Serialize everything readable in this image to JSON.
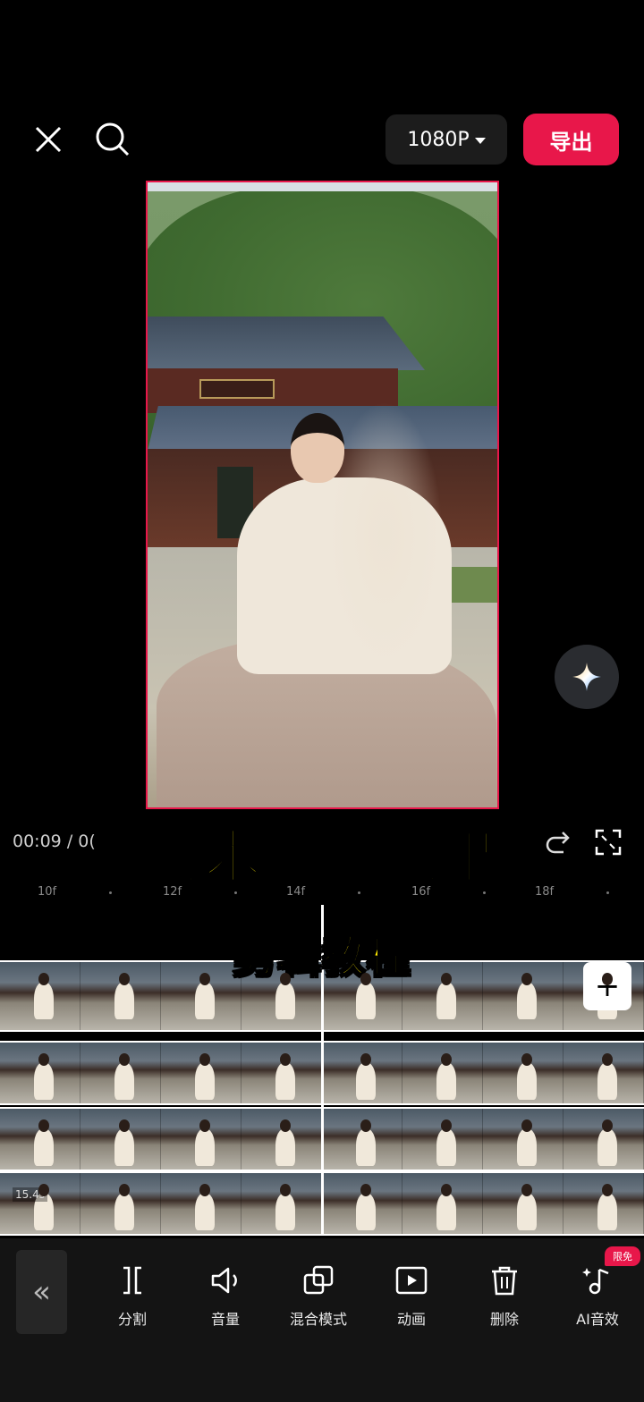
{
  "header": {
    "resolution_label": "1080P",
    "export_label": "导出"
  },
  "playback": {
    "time_current": "00:09",
    "time_separator": "/ 0("
  },
  "overlay": {
    "title": "武术残影效果",
    "subtitle": "剪辑教程"
  },
  "ruler": {
    "labels": [
      "10f",
      "12f",
      "14f",
      "16f",
      "18f"
    ]
  },
  "timeline": {
    "duration_badge": "15.4s",
    "track_count": 4,
    "add_label": "+"
  },
  "toolbar": {
    "back_label": "«",
    "items": [
      {
        "label": "分割",
        "icon": "split-icon"
      },
      {
        "label": "音量",
        "icon": "volume-icon"
      },
      {
        "label": "混合模式",
        "icon": "blend-mode-icon"
      },
      {
        "label": "动画",
        "icon": "animation-icon"
      },
      {
        "label": "删除",
        "icon": "delete-icon"
      },
      {
        "label": "AI音效",
        "icon": "ai-sound-icon"
      }
    ],
    "new_badge": "限免"
  },
  "colors": {
    "accent": "#e8174a",
    "title_yellow": "#ffea00",
    "background": "#000000"
  }
}
